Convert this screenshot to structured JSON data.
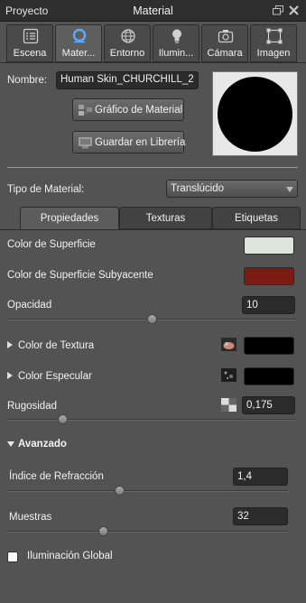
{
  "titlebar": {
    "left": "Proyecto",
    "center": "Material"
  },
  "top_tabs": [
    {
      "label": "Escena",
      "icon": "list-icon"
    },
    {
      "label": "Mater...",
      "icon": "material-icon",
      "active": true
    },
    {
      "label": "Entorno",
      "icon": "globe-icon"
    },
    {
      "label": "Ilumin...",
      "icon": "lightbulb-icon"
    },
    {
      "label": "Cámara",
      "icon": "camera-icon"
    },
    {
      "label": "Imagen",
      "icon": "image-frame-icon"
    }
  ],
  "name": {
    "label": "Nombre:",
    "value": "Human Skin_CHURCHILL_2"
  },
  "buttons": {
    "graph": "Gráfico de Material",
    "save": "Guardar en Librería"
  },
  "material_type": {
    "label": "Tipo de Material:",
    "value": "Translúcido"
  },
  "prop_tabs": [
    {
      "label": "Propiedades",
      "active": true
    },
    {
      "label": "Texturas"
    },
    {
      "label": "Etiquetas"
    }
  ],
  "props": {
    "surface_color": {
      "label": "Color de Superficie",
      "color": "#dde6da"
    },
    "subsurface_color": {
      "label": "Color de Superficie Subyacente",
      "color": "#7a1c14"
    },
    "opacity": {
      "label": "Opacidad",
      "value": "10",
      "level": 0.5
    },
    "texture_color": {
      "label": "Color de Textura",
      "color": "#000000"
    },
    "specular_color": {
      "label": "Color Especular",
      "color": "#000000"
    },
    "roughness": {
      "label": "Rugosidad",
      "value": "0,175",
      "level": 0.19
    }
  },
  "advanced": {
    "label": "Avanzado",
    "refraction": {
      "label": "Índice de Refracción",
      "value": "1,4",
      "level": 0.4
    },
    "samples": {
      "label": "Muestras",
      "value": "32",
      "level": 0.34
    },
    "global_illum": {
      "label": "Iluminación Global",
      "checked": false
    }
  },
  "colors": {
    "panel": "#535353",
    "titlebar": "#2e2e2e",
    "field": "#2b2b2b"
  }
}
